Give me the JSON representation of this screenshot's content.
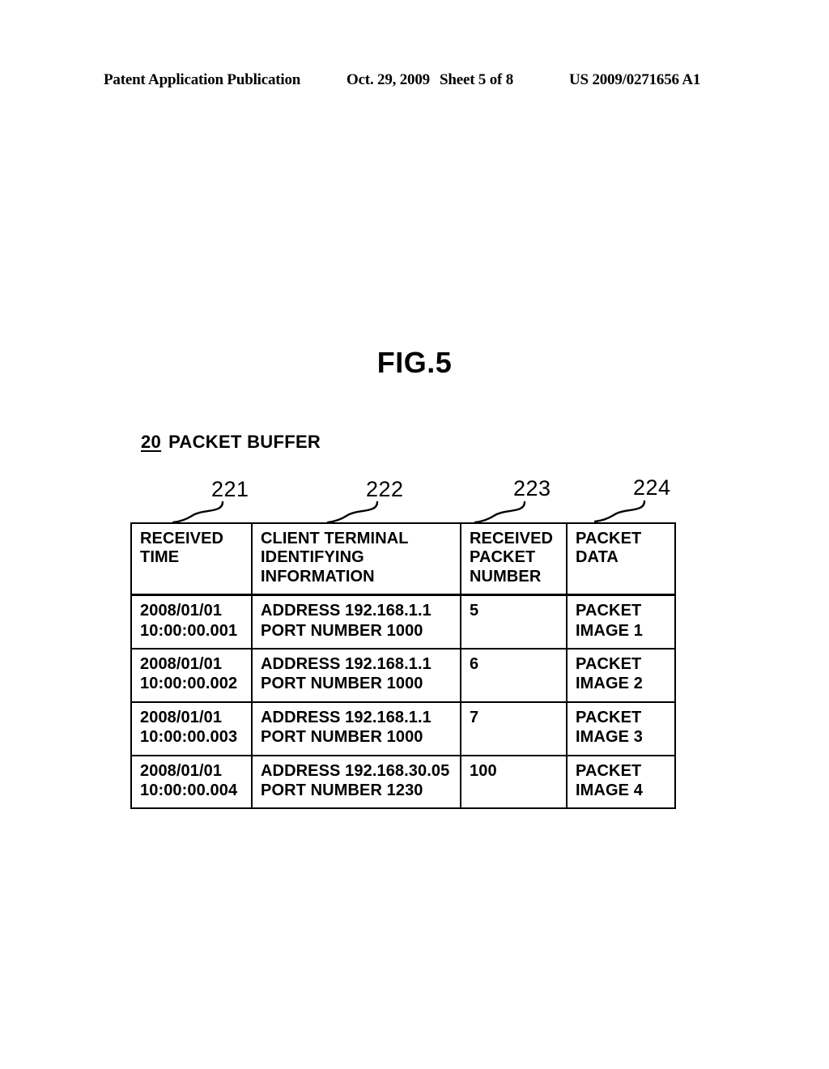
{
  "page_header": {
    "publication": "Patent Application Publication",
    "date": "Oct. 29, 2009",
    "sheet": "Sheet 5 of 8",
    "publication_number": "US 2009/0271656 A1"
  },
  "figure": {
    "title": "FIG.5",
    "caption_ref": "20",
    "caption_text": "PACKET BUFFER"
  },
  "reference_numerals": {
    "col1": "221",
    "col2": "222",
    "col3": "223",
    "col4": "224"
  },
  "table": {
    "headers": {
      "received_time": [
        "RECEIVED",
        "TIME"
      ],
      "client_terminal": [
        "CLIENT TERMINAL",
        "IDENTIFYING",
        "INFORMATION"
      ],
      "received_packet_number": [
        "RECEIVED",
        "PACKET",
        "NUMBER"
      ],
      "packet_data": [
        "PACKET",
        "DATA"
      ]
    },
    "rows": [
      {
        "time_line1": "2008/01/01",
        "time_line2": "10:00:00.001",
        "client_line1": "ADDRESS 192.168.1.1",
        "client_line2": "PORT NUMBER 1000",
        "packet_number": "5",
        "packet_data_line1": "PACKET",
        "packet_data_line2": "IMAGE 1"
      },
      {
        "time_line1": "2008/01/01",
        "time_line2": "10:00:00.002",
        "client_line1": "ADDRESS 192.168.1.1",
        "client_line2": "PORT NUMBER 1000",
        "packet_number": "6",
        "packet_data_line1": "PACKET",
        "packet_data_line2": "IMAGE 2"
      },
      {
        "time_line1": "2008/01/01",
        "time_line2": "10:00:00.003",
        "client_line1": "ADDRESS 192.168.1.1",
        "client_line2": "PORT NUMBER 1000",
        "packet_number": "7",
        "packet_data_line1": "PACKET",
        "packet_data_line2": "IMAGE 3"
      },
      {
        "time_line1": "2008/01/01",
        "time_line2": "10:00:00.004",
        "client_line1": "ADDRESS 192.168.30.05",
        "client_line2": "PORT NUMBER 1230",
        "packet_number": "100",
        "packet_data_line1": "PACKET",
        "packet_data_line2": "IMAGE 4"
      }
    ]
  },
  "colors": {
    "ink": "#000000",
    "paper": "#ffffff"
  }
}
